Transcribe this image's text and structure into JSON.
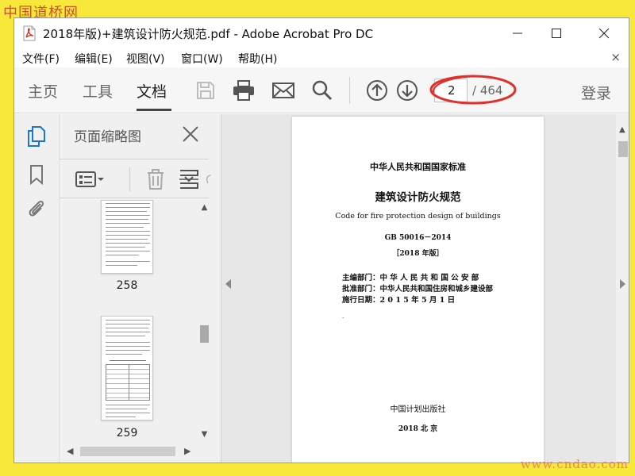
{
  "watermarks": {
    "top": "中国道桥网",
    "bottom": "www.cndao.com"
  },
  "window": {
    "title": "2018年版)+建筑设计防火规范.pdf - Adobe Acrobat Pro DC"
  },
  "menu": {
    "items": [
      {
        "label": "文件(F)"
      },
      {
        "label": "编辑(E)"
      },
      {
        "label": "视图(V)"
      },
      {
        "label": "窗口(W)"
      },
      {
        "label": "帮助(H)"
      }
    ],
    "close_glyph": "×"
  },
  "toolbar": {
    "tabs": [
      {
        "label": "主页",
        "active": false
      },
      {
        "label": "工具",
        "active": false
      },
      {
        "label": "文档",
        "active": true
      }
    ],
    "icons": [
      "save-icon",
      "print-icon",
      "email-icon",
      "search-icon",
      "page-up-icon",
      "page-down-icon"
    ],
    "current_page": "2",
    "page_total": "/ 464",
    "login_label": "登录"
  },
  "thumbnails_panel": {
    "title": "页面缩略图",
    "thumbnails": [
      {
        "page_label": "258"
      },
      {
        "page_label": "259"
      }
    ]
  },
  "document_page": {
    "national_standard": "中华人民共和国国家标准",
    "title_cn": "建筑设计防火规范",
    "title_en": "Code for fire protection design of buildings",
    "code": "GB 50016－2014",
    "edition": "［2018 年版］",
    "editor_dept": "主编部门：中 华 人 民 共 和 国 公 安 部",
    "approval_dept": "批准部门：中华人民共和国住房和城乡建设部",
    "effective_date": "施行日期：2 0 1 5   年   5   月   1   日",
    "dot": ".",
    "publisher": "中国计划出版社",
    "place_year": "2018   北     京"
  },
  "colors": {
    "background": "#f7e83a",
    "annotation_red": "#e0302a",
    "pdf_red": "#d9261c"
  }
}
